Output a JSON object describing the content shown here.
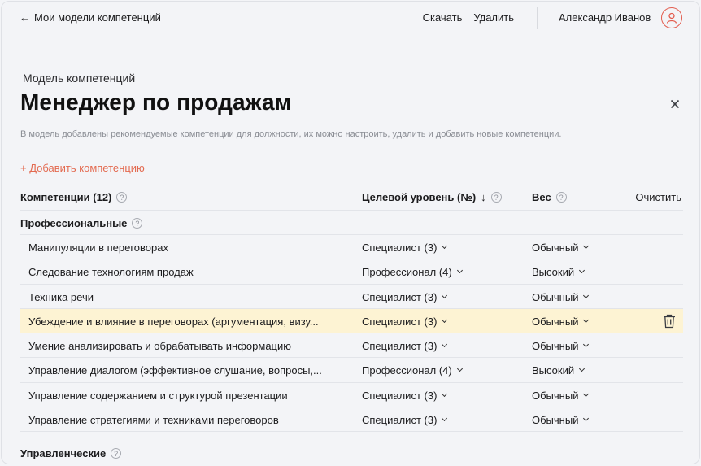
{
  "nav": {
    "back_label": "Мои модели компетенций",
    "back_arrow": "←",
    "download_label": "Скачать",
    "delete_label": "Удалить",
    "user_name": "Александр Иванов"
  },
  "header": {
    "eyebrow": "Модель компетенций",
    "title": "Менеджер по продажам",
    "hint": "В модель добавлены рекомендуемые компетенции для должности, их можно настроить, удалить и добавить новые компетенции.",
    "add_label": "+ Добавить компетенцию"
  },
  "table": {
    "col_competencies": "Компетенции (12)",
    "col_level": "Целевой  уровень (№)",
    "sort_arrow": "↓",
    "col_weight": "Вес",
    "clear_label": "Очистить",
    "help_glyph": "?"
  },
  "groups": [
    {
      "title": "Профессиональные",
      "rows": [
        {
          "name": "Манипуляции в переговорах",
          "level": "Специалист (3)",
          "weight": "Обычный"
        },
        {
          "name": "Следование технологиям продаж",
          "level": "Профессионал (4)",
          "weight": "Высокий"
        },
        {
          "name": "Техника речи",
          "level": "Специалист (3)",
          "weight": "Обычный"
        },
        {
          "name": "Убеждение и влияние в переговорах (аргументация, визу...",
          "level": "Специалист (3)",
          "weight": "Обычный",
          "highlighted": true
        },
        {
          "name": "Умение анализировать и обрабатывать информацию",
          "level": "Специалист (3)",
          "weight": "Обычный"
        },
        {
          "name": "Управление диалогом (эффективное слушание, вопросы,...",
          "level": "Профессионал (4)",
          "weight": "Высокий"
        },
        {
          "name": "Управление содержанием и структурой презентации",
          "level": "Специалист (3)",
          "weight": "Обычный"
        },
        {
          "name": "Управление стратегиями и техниками переговоров",
          "level": "Специалист (3)",
          "weight": "Обычный"
        }
      ]
    },
    {
      "title": "Управленческие",
      "rows": []
    }
  ],
  "colors": {
    "accent": "#e36a50",
    "highlight_row": "#fdf3d3",
    "background": "#f3f4f7"
  },
  "icons": {
    "avatar": "user-avatar-icon",
    "close": "close-icon",
    "help": "help-circle-icon",
    "dropdown": "chevron-down-icon",
    "delete_row": "trash-icon"
  }
}
